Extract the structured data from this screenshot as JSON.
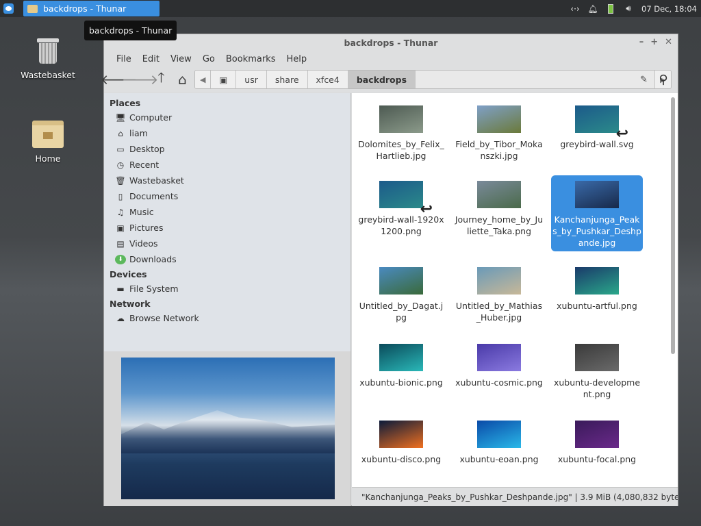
{
  "panel": {
    "task_title": "backdrops - Thunar",
    "clock": "07 Dec, 18:04"
  },
  "tooltip": "backdrops - Thunar",
  "desktop": {
    "icons": [
      {
        "label": "Wastebasket"
      },
      {
        "label": "Home"
      }
    ]
  },
  "window": {
    "title": "backdrops - Thunar",
    "menu": [
      "File",
      "Edit",
      "View",
      "Go",
      "Bookmarks",
      "Help"
    ],
    "path": [
      "usr",
      "share",
      "xfce4",
      "backdrops"
    ],
    "sidebar": {
      "places_header": "Places",
      "places": [
        {
          "label": "Computer",
          "icon": "computer-icon"
        },
        {
          "label": "liam",
          "icon": "home-icon"
        },
        {
          "label": "Desktop",
          "icon": "desktop-icon"
        },
        {
          "label": "Recent",
          "icon": "recent-icon"
        },
        {
          "label": "Wastebasket",
          "icon": "trash-icon"
        },
        {
          "label": "Documents",
          "icon": "documents-icon"
        },
        {
          "label": "Music",
          "icon": "music-icon"
        },
        {
          "label": "Pictures",
          "icon": "pictures-icon"
        },
        {
          "label": "Videos",
          "icon": "videos-icon"
        },
        {
          "label": "Downloads",
          "icon": "downloads-icon"
        }
      ],
      "devices_header": "Devices",
      "devices": [
        {
          "label": "File System",
          "icon": "drive-icon"
        }
      ],
      "network_header": "Network",
      "network": [
        {
          "label": "Browse Network",
          "icon": "network-icon"
        }
      ]
    },
    "files": [
      {
        "name": "Dolomites_by_Felix_Hartlieb.jpg",
        "c1": "#4d5a52",
        "c2": "#8b9a8a",
        "link": false
      },
      {
        "name": "Field_by_Tibor_Mokanszki.jpg",
        "c1": "#7fa0c8",
        "c2": "#6b7a3a",
        "link": false
      },
      {
        "name": "greybird-wall.svg",
        "c1": "#1c5a8a",
        "c2": "#2b8a8a",
        "link": true
      },
      {
        "name": "greybird-wall-1920x1200.png",
        "c1": "#1c5a8a",
        "c2": "#2b8a8a",
        "link": true
      },
      {
        "name": "Journey_home_by_Juliette_Taka.png",
        "c1": "#7a8a9a",
        "c2": "#4a6a4a",
        "link": false
      },
      {
        "name": "Kanchanjunga_Peaks_by_Pushkar_Deshpande.jpg",
        "c1": "#3a6aa8",
        "c2": "#17294a",
        "link": false
      },
      {
        "name": "Untitled_by_Dagat.jpg",
        "c1": "#4a8ac0",
        "c2": "#3a6a3a",
        "link": false
      },
      {
        "name": "Untitled_by_Mathias_Huber.jpg",
        "c1": "#6a9ab8",
        "c2": "#c8b898",
        "link": false
      },
      {
        "name": "xubuntu-artful.png",
        "c1": "#1a3a6a",
        "c2": "#2aa88a",
        "link": false
      },
      {
        "name": "xubuntu-bionic.png",
        "c1": "#0a4a5a",
        "c2": "#2ab8b8",
        "link": false
      },
      {
        "name": "xubuntu-cosmic.png",
        "c1": "#4a3aa8",
        "c2": "#8a7ae0",
        "link": false
      },
      {
        "name": "xubuntu-development.png",
        "c1": "#3a3a3a",
        "c2": "#6a6a6a",
        "link": false
      },
      {
        "name": "xubuntu-disco.png",
        "c1": "#0a1a3a",
        "c2": "#f07020",
        "link": false
      },
      {
        "name": "xubuntu-eoan.png",
        "c1": "#0a4aa8",
        "c2": "#2ab8e8",
        "link": false
      },
      {
        "name": "xubuntu-focal.png",
        "c1": "#3a1a5a",
        "c2": "#6a2a8a",
        "link": false
      }
    ],
    "selected_index": 5,
    "status": "\"Kanchanjunga_Peaks_by_Pushkar_Deshpande.jpg\"  |  3.9 MiB (4,080,832 byte..."
  },
  "colors": {
    "accent": "#3a8fe0",
    "panel_bg": "#2d2f31",
    "sidebar_bg": "#dfe3e8"
  }
}
